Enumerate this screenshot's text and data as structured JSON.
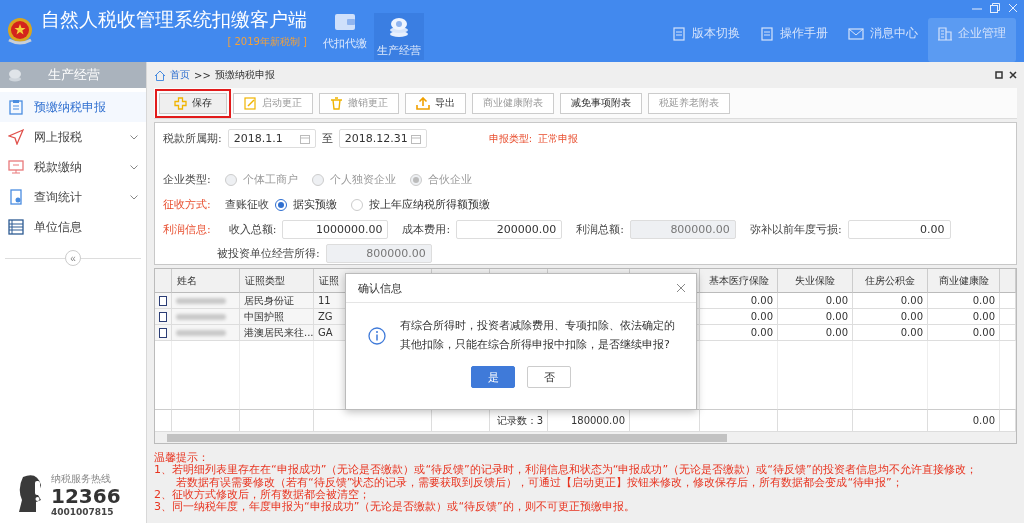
{
  "window": {
    "title": "自然人税收管理系统扣缴客户端",
    "subtitle": "[ 2019年新税制 ]"
  },
  "top_tabs": [
    {
      "label": "代扣代缴",
      "selected": false,
      "kind": "wallet"
    },
    {
      "label": "生产经营",
      "selected": true,
      "kind": "coins"
    }
  ],
  "top_links": [
    {
      "label": "版本切换",
      "kind": "doc",
      "selected": false
    },
    {
      "label": "操作手册",
      "kind": "doc",
      "selected": false
    },
    {
      "label": "消息中心",
      "kind": "mail",
      "selected": false
    },
    {
      "label": "企业管理",
      "kind": "building",
      "selected": true
    }
  ],
  "sidebar": {
    "title": "生产经营",
    "items": [
      {
        "label": "预缴纳税申报",
        "kind": "clipboard",
        "selected": true,
        "expandable": false
      },
      {
        "label": "网上报税",
        "kind": "send",
        "selected": false,
        "expandable": true
      },
      {
        "label": "税款缴纳",
        "kind": "monitor",
        "selected": false,
        "expandable": true
      },
      {
        "label": "查询统计",
        "kind": "report",
        "selected": false,
        "expandable": true
      },
      {
        "label": "单位信息",
        "kind": "list",
        "selected": false,
        "expandable": false
      }
    ],
    "collapse": "«",
    "hotline": {
      "label": "纳税服务热线",
      "number": "12366",
      "phone": "4001007815"
    }
  },
  "breadcrumb": {
    "home": "首页",
    "separator": ">>",
    "current": "预缴纳税申报"
  },
  "toolbar": [
    {
      "label": "保存",
      "kind": "plus",
      "disabled": false,
      "focused": true
    },
    {
      "label": "启动更正",
      "kind": "edit",
      "disabled": true,
      "focused": false
    },
    {
      "label": "撤销更正",
      "kind": "trash",
      "disabled": true,
      "focused": false
    },
    {
      "label": "导出",
      "kind": "export",
      "disabled": false,
      "focused": false
    },
    {
      "label": "商业健康附表",
      "kind": "text",
      "disabled": true,
      "focused": false
    },
    {
      "label": "减免事项附表",
      "kind": "text",
      "disabled": false,
      "focused": false
    },
    {
      "label": "税延养老附表",
      "kind": "text",
      "disabled": true,
      "focused": false
    }
  ],
  "form": {
    "period_label": "税款所属期:",
    "period_from": "2018.1.1",
    "period_to_label": "至",
    "period_to": "2018.12.31",
    "type_label": "申报类型:",
    "type_value": "正常申报",
    "enterprise_label": "企业类型:",
    "enterprise_options": [
      {
        "label": "个体工商户",
        "selected": false
      },
      {
        "label": "个人独资企业",
        "selected": false
      },
      {
        "label": "合伙企业",
        "selected": true
      }
    ],
    "collection_label": "征收方式:",
    "collection_method": "查账征收",
    "collection_options": [
      {
        "label": "据实预缴",
        "selected": true
      },
      {
        "label": "按上年应纳税所得额预缴",
        "selected": false
      }
    ],
    "profit_label": "利润信息:",
    "profit_fields": [
      {
        "label": "收入总额:",
        "value": "1000000.00",
        "readonly": false
      },
      {
        "label": "成本费用:",
        "value": "200000.00",
        "readonly": false
      },
      {
        "label": "利润总额:",
        "value": "800000.00",
        "readonly": true
      },
      {
        "label": "弥补以前年度亏损:",
        "value": "0.00",
        "readonly": false
      }
    ],
    "income_field": {
      "label": "被投资单位经营所得:",
      "value": "800000.00",
      "readonly": true
    }
  },
  "table": {
    "left_columns": [
      "姓名",
      "证照类型",
      "证照"
    ],
    "right_columns": [
      "基本医疗保险",
      "失业保险",
      "住房公积金",
      "商业健康险"
    ],
    "rows": [
      {
        "checked": false,
        "id_type": "居民身份证",
        "id_number": "11",
        "values": [
          "0.00",
          "0.00",
          "0.00",
          "0.00"
        ]
      },
      {
        "checked": false,
        "id_type": "中国护照",
        "id_number": "ZG",
        "values": [
          "0.00",
          "0.00",
          "0.00",
          "0.00"
        ]
      },
      {
        "checked": false,
        "id_type": "港澳居民来往...",
        "id_number": "GA",
        "values": [
          "0.00",
          "0.00",
          "0.00",
          "0.00"
        ]
      }
    ],
    "footer": {
      "count": "记录数：3",
      "total": "180000.00",
      "last": "0.00"
    }
  },
  "dialog": {
    "title": "确认信息",
    "message": "有综合所得时，投资者减除费用、专项扣除、依法确定的其他扣除，只能在综合所得申报中扣除，是否继续申报?",
    "buttons": [
      {
        "label": "是",
        "primary": true
      },
      {
        "label": "否",
        "primary": false
      }
    ]
  },
  "notes": {
    "title": "温馨提示：",
    "lines": [
      "1、若明细列表里存在在“申报成功”（无论是否缴款）或“待反馈”的记录时，利润信息和状态为“申报成功”（无论是否缴款）或“待反馈”的投资者信息均不允许直接修改；",
      "若数据有误需要修改（若有“待反馈”状态的记录，需要获取到反馈后），可通过【启动更正】按钮来修改，修改保存后，所有数据都会变成“待申报”；",
      "2、征收方式修改后，所有数据都会被清空；",
      "3、同一纳税年度，年度申报为“申报成功”（无论是否缴款）或“待反馈”的，则不可更正预缴申报。"
    ]
  }
}
